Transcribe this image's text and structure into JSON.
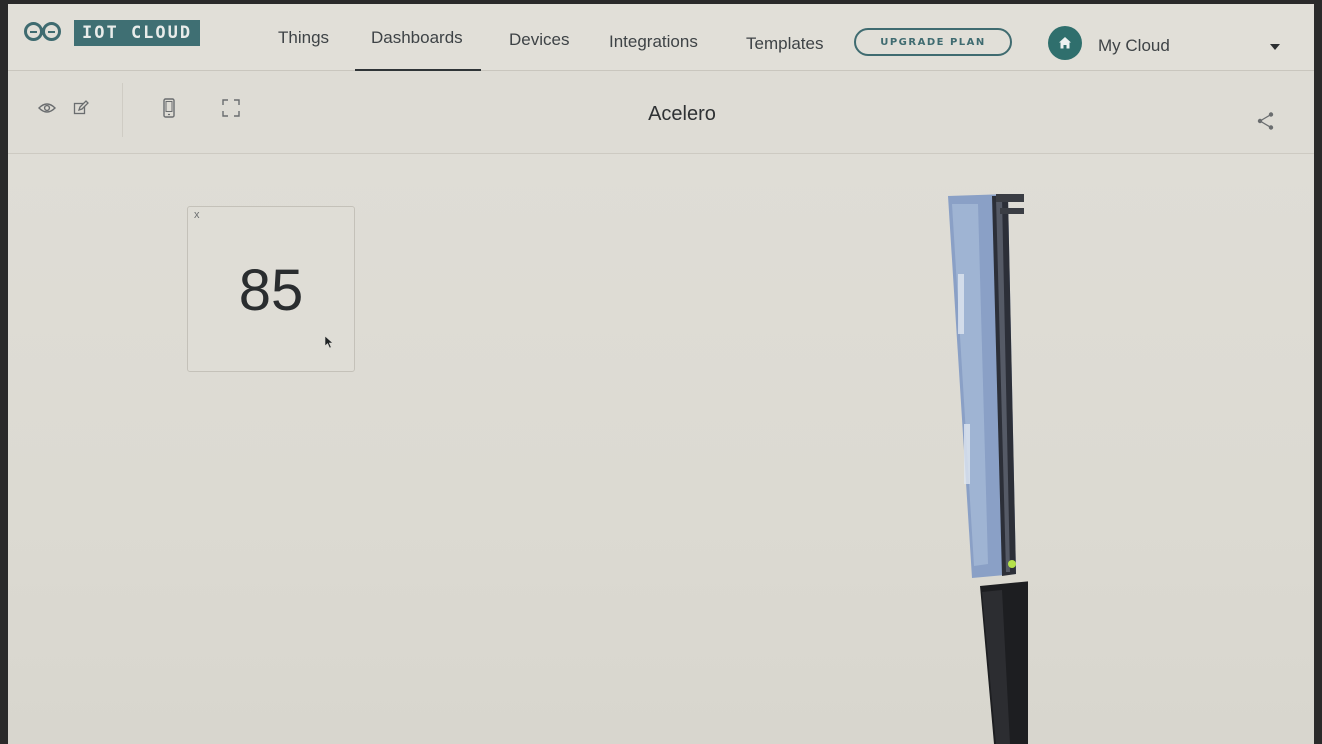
{
  "brand": {
    "logo_text": "IOT CLOUD"
  },
  "nav": {
    "items": [
      {
        "label": "Things"
      },
      {
        "label": "Dashboards"
      },
      {
        "label": "Devices"
      },
      {
        "label": "Integrations"
      },
      {
        "label": "Templates"
      }
    ],
    "active": "Dashboards",
    "upgrade_label": "UPGRADE PLAN",
    "account_label": "My Cloud"
  },
  "toolbar": {
    "icons": [
      "eye-icon",
      "edit-icon",
      "mobile-icon",
      "fullscreen-icon",
      "share-icon"
    ],
    "dashboard_title": "Acelero"
  },
  "widgets": [
    {
      "close_label": "x",
      "value": "85"
    }
  ],
  "colors": {
    "accent": "#3f6b70",
    "background": "#dcdad3"
  }
}
